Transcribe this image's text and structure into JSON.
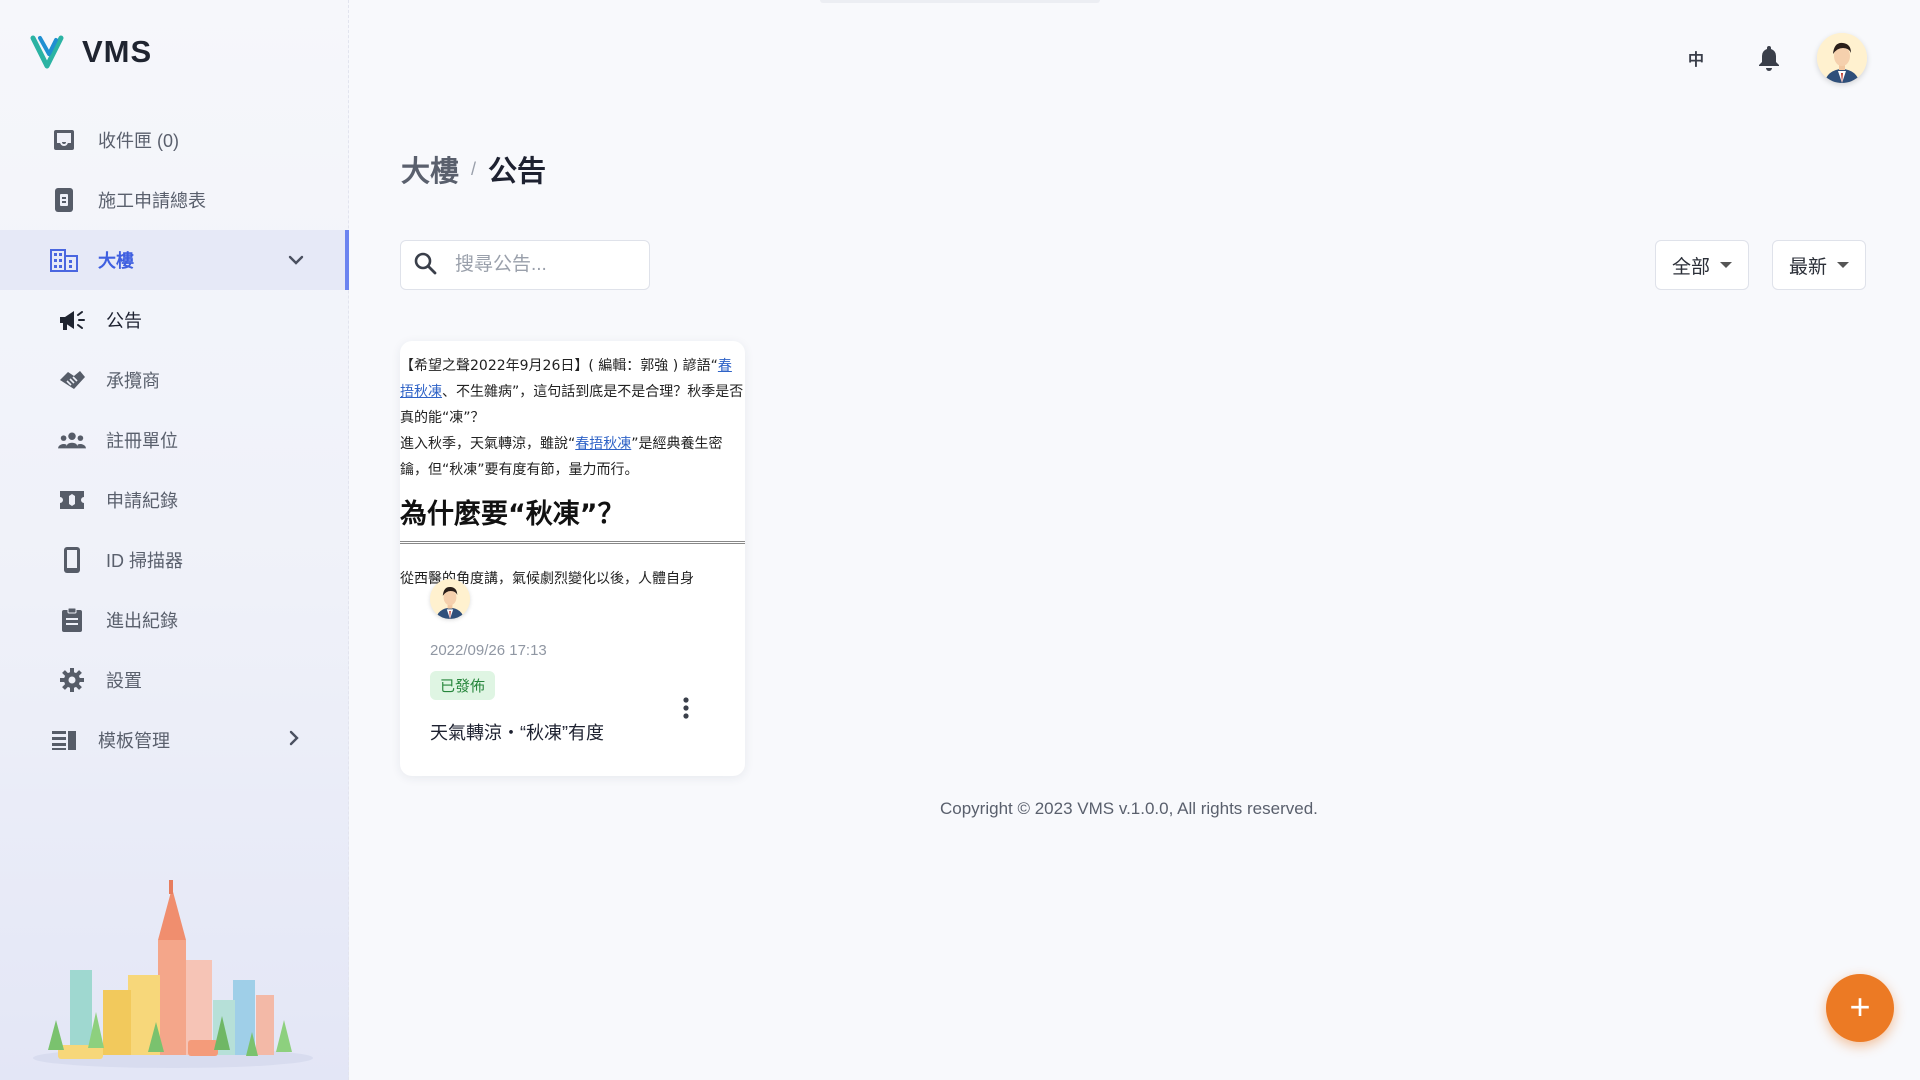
{
  "app": {
    "name": "VMS",
    "accent": "#3f5fe0",
    "fab_color": "#ec7a24"
  },
  "sidebar": {
    "items": [
      {
        "label": "收件匣 (0)",
        "icon": "inbox-icon"
      },
      {
        "label": "施工申請總表",
        "icon": "document-icon"
      },
      {
        "label": "大樓",
        "icon": "building-icon",
        "expanded": true
      },
      {
        "label": "公告",
        "icon": "megaphone-icon"
      },
      {
        "label": "承攬商",
        "icon": "handshake-icon"
      },
      {
        "label": "註冊單位",
        "icon": "group-icon"
      },
      {
        "label": "申請紀錄",
        "icon": "ticket-icon"
      },
      {
        "label": "ID 掃描器",
        "icon": "phone-icon"
      },
      {
        "label": "進出紀錄",
        "icon": "clipboard-icon"
      },
      {
        "label": "設置",
        "icon": "gear-icon"
      },
      {
        "label": "模板管理",
        "icon": "template-icon"
      }
    ]
  },
  "header": {
    "lang": "中"
  },
  "breadcrumb": {
    "parent": "大樓",
    "separator": "/",
    "current": "公告"
  },
  "search": {
    "placeholder": "搜尋公告..."
  },
  "filters": {
    "scope": "全部",
    "sort": "最新"
  },
  "card": {
    "preview": {
      "p1_a": "【希望之聲2022年9月26日】( 編輯：郭強 ) 諺語“",
      "p1_link": "春捂秋凍",
      "p1_b": "、不生雜病”，這句話到底是不是合理？秋季是否真的能“凍”？",
      "p2_a": "進入秋季，天氣轉涼，雖說“",
      "p2_link": "春捂秋凍",
      "p2_b": "”是經典養生密鑰，但“秋凍”要有度有節，量力而行。",
      "heading": "為什麼要“秋凍”？",
      "p3": "從西醫的角度講，氣候劇烈變化以後，人體自身"
    },
    "date": "2022/09/26 17:13",
    "status": "已發佈",
    "title": "天氣轉涼・“秋凍”有度"
  },
  "footer": {
    "copyright": "Copyright © 2023 VMS v.1.0.0, All rights reserved."
  },
  "fab": {
    "label": "+"
  }
}
